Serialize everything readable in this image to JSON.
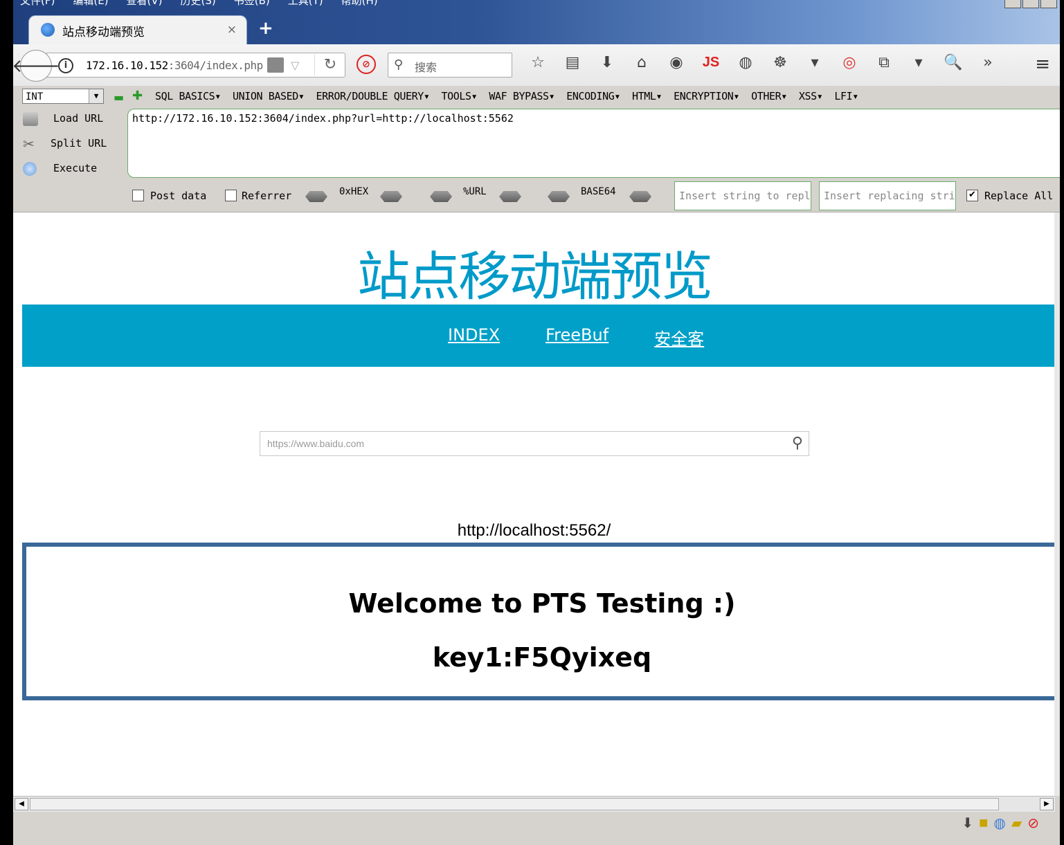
{
  "menubar": [
    "文件(F)",
    "编辑(E)",
    "查看(V)",
    "历史(S)",
    "书签(B)",
    "工具(T)",
    "帮助(H)"
  ],
  "tab": {
    "title": "站点移动端预览",
    "close": "×",
    "new_tab": "+"
  },
  "address_bar": {
    "host": "172.16.10.152",
    "rest": ":3604/index.php"
  },
  "search": {
    "placeholder": "搜索"
  },
  "toolbar": {
    "js_label": "JS",
    "overflow": "»",
    "menu": "≡"
  },
  "hackbar": {
    "select_value": "INT",
    "menus": [
      "SQL BASICS▾",
      "UNION BASED▾",
      "ERROR/DOUBLE QUERY▾",
      "TOOLS▾",
      "WAF BYPASS▾",
      "ENCODING▾",
      "HTML▾",
      "ENCRYPTION▾",
      "OTHER▾",
      "XSS▾",
      "LFI▾"
    ],
    "actions": {
      "load": "Load URL",
      "split": "Split URL",
      "execute": "Execute"
    },
    "url_value": "http://172.16.10.152:3604/index.php?url=http://localhost:5562",
    "post_data_label": "Post data",
    "referrer_label": "Referrer",
    "hex_label": "0xHEX",
    "url_enc_label": "%URL",
    "base64_label": "BASE64",
    "replace_from_placeholder": "Insert string to replace",
    "replace_to_placeholder": "Insert replacing string",
    "replace_all_label": "Replace All",
    "replace_all_checked": true
  },
  "page": {
    "title": "站点移动端预览",
    "nav": [
      "INDEX",
      "FreeBuf",
      "安全客"
    ],
    "search_placeholder": "https://www.baidu.com",
    "fetched_url": "http://localhost:5562/",
    "welcome": "Welcome to PTS Testing :)",
    "key": "key1:F5Qyixeq"
  },
  "colors": {
    "accent": "#00a0c8",
    "title": "#009ac9",
    "frame_border": "#3a6898"
  }
}
